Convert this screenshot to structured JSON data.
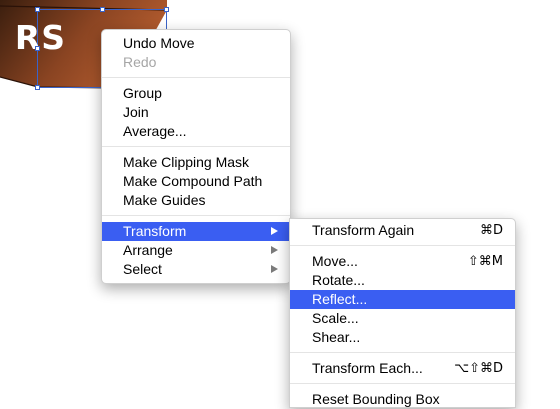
{
  "artwork": {
    "text": "RS",
    "colors": {
      "fill_dark": "#3a1e0e",
      "fill_mid": "#8a4422",
      "fill_light": "#b55d2f",
      "selection": "#3a63c8"
    }
  },
  "context_menu": {
    "groups": [
      [
        {
          "label": "Undo Move",
          "disabled": false
        },
        {
          "label": "Redo",
          "disabled": true
        }
      ],
      [
        {
          "label": "Group"
        },
        {
          "label": "Join"
        },
        {
          "label": "Average..."
        }
      ],
      [
        {
          "label": "Make Clipping Mask"
        },
        {
          "label": "Make Compound Path"
        },
        {
          "label": "Make Guides"
        }
      ],
      [
        {
          "label": "Transform",
          "submenu": true,
          "highlighted": true
        },
        {
          "label": "Arrange",
          "submenu": true
        },
        {
          "label": "Select",
          "submenu": true
        }
      ]
    ]
  },
  "transform_submenu": {
    "items": [
      {
        "label": "Transform Again",
        "shortcut": "⌘D"
      },
      {
        "label": "Move...",
        "shortcut": "⇧⌘M"
      },
      {
        "label": "Rotate..."
      },
      {
        "label": "Reflect...",
        "highlighted": true
      },
      {
        "label": "Scale..."
      },
      {
        "label": "Shear..."
      },
      {
        "label": "Transform Each...",
        "shortcut": "⌥⇧⌘D"
      },
      {
        "label": "Reset Bounding Box"
      }
    ]
  },
  "colors": {
    "highlight": "#3a5ef2",
    "disabled_text": "#a6a6a6",
    "separator": "#e4e4e4"
  }
}
